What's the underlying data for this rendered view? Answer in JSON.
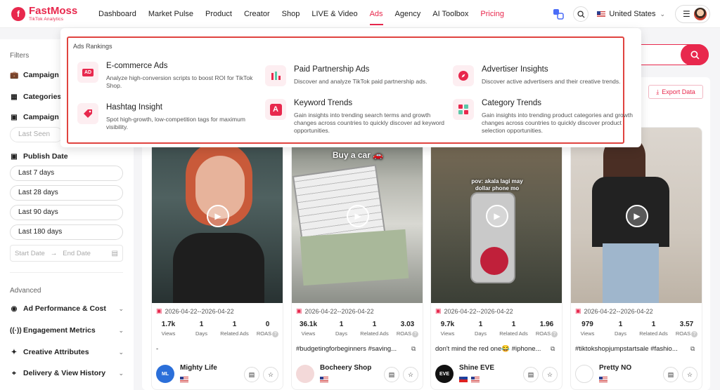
{
  "brand": {
    "name": "FastMoss",
    "sub": "TikTok Analytics",
    "mark": "f"
  },
  "nav": {
    "items": [
      "Dashboard",
      "Market Pulse",
      "Product",
      "Creator",
      "Shop",
      "LIVE & Video",
      "Ads",
      "Agency",
      "AI Toolbox",
      "Pricing"
    ],
    "active": "Ads"
  },
  "header": {
    "country": "United States",
    "menu_icon": "☰"
  },
  "sidebar": {
    "filters_label": "Filters",
    "campaign_type": "Campaign Ty",
    "categories": "Categories",
    "campaign_p": "Campaign P",
    "last_seen_placeholder": "Last Seen",
    "publish_date": "Publish Date",
    "date_options": [
      "Last 7 days",
      "Last 28 days",
      "Last 90 days",
      "Last 180 days"
    ],
    "start_date_placeholder": "Start Date",
    "end_date_placeholder": "End Date",
    "advanced_label": "Advanced",
    "advanced_items": [
      "Ad Performance & Cost",
      "Engagement Metrics",
      "Creative Attributes",
      "Delivery & View History"
    ]
  },
  "search": {
    "text": "k"
  },
  "export_label": "Export Data",
  "dropdown": {
    "heading": "Ads Rankings",
    "items": [
      {
        "title": "E-commerce Ads",
        "desc": "Analyze high-conversion scripts to boost ROI for TikTok Shop.",
        "icon": "ad-icon"
      },
      {
        "title": "Paid Partnership Ads",
        "desc": "Discover and analyze TikTok paid partnership ads.",
        "icon": "bar-chart-icon"
      },
      {
        "title": "Advertiser Insights",
        "desc": "Discover active advertisers and their creative trends.",
        "icon": "compass-icon"
      },
      {
        "title": "Hashtag Insight",
        "desc": "Spot high-growth, low-competition tags for maximum visibility.",
        "icon": "tag-icon"
      },
      {
        "title": "Keyword Trends",
        "desc": "Gain insights into trending search terms and growth changes across countries to quickly discover ad keyword opportunities.",
        "icon": "letter-a-icon"
      },
      {
        "title": "Category Trends",
        "desc": "Gain insights into trending product categories and growth changes across countries to quickly discover product selection opportunities.",
        "icon": "grid-icon"
      }
    ]
  },
  "stat_labels": {
    "views": "Views",
    "days": "Days",
    "related": "Related Ads",
    "roas": "ROAS"
  },
  "cards": [
    {
      "date": "2026-04-22--2026-04-22",
      "views": "1.7k",
      "days": "1",
      "related": "1",
      "roas": "0",
      "title": "-",
      "shop": "Mighty Life",
      "shop_logo": "ML",
      "overlay_top": "",
      "overlay_mid": ""
    },
    {
      "date": "2026-04-22--2026-04-22",
      "views": "36.1k",
      "days": "1",
      "related": "1",
      "roas": "3.03",
      "title": "#budgetingforbeginners #saving...",
      "shop": "Bocheery Shop",
      "shop_logo": "",
      "overlay_top": "Buy a car 🚗",
      "overlay_mid": ""
    },
    {
      "date": "2026-04-22--2026-04-22",
      "views": "9.7k",
      "days": "1",
      "related": "1",
      "roas": "1.96",
      "title": "don't mind the red one😂 #iphone...",
      "shop": "Shine EVE",
      "shop_logo": "EVE",
      "overlay_top": "",
      "overlay_mid": "pov: akala lagi may dollar phone mo"
    },
    {
      "date": "2026-04-22--2026-04-22",
      "views": "979",
      "days": "1",
      "related": "1",
      "roas": "3.57",
      "title": "#tiktokshopjumpstartsale #fashio...",
      "shop": "Pretty NO",
      "shop_logo": "",
      "overlay_top": "",
      "overlay_mid": ""
    }
  ],
  "colors": {
    "accent": "#e8284d",
    "highlight_frame": "#e0433f"
  }
}
